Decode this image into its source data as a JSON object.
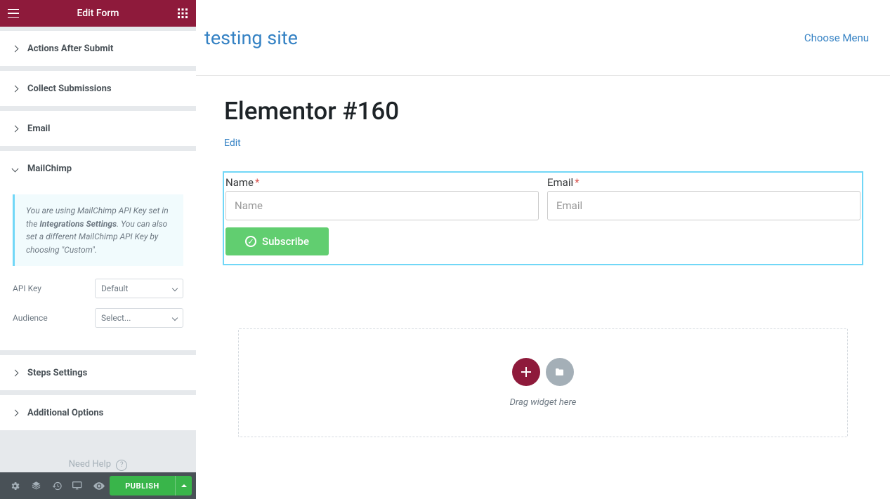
{
  "header": {
    "title": "Edit Form"
  },
  "sections": {
    "actions": "Actions After Submit",
    "collect": "Collect Submissions",
    "email": "Email",
    "mailchimp": "MailChimp",
    "steps": "Steps Settings",
    "additional": "Additional Options"
  },
  "mailchimp": {
    "notice_pre": "You are using MailChimp API Key set in the ",
    "notice_bold": "Integrations Settings",
    "notice_post": ". You can also set a different MailChimp API Key by choosing \"Custom\".",
    "api_key_label": "API Key",
    "api_key_value": "Default",
    "audience_label": "Audience",
    "audience_value": "Select..."
  },
  "help": "Need Help",
  "footer": {
    "publish": "PUBLISH"
  },
  "site": {
    "name": "testing site",
    "menu": "Choose Menu"
  },
  "page": {
    "title": "Elementor #160",
    "edit": "Edit"
  },
  "form": {
    "name_label": "Name",
    "name_placeholder": "Name",
    "email_label": "Email",
    "email_placeholder": "Email",
    "subscribe": "Subscribe"
  },
  "drop": {
    "text": "Drag widget here"
  }
}
